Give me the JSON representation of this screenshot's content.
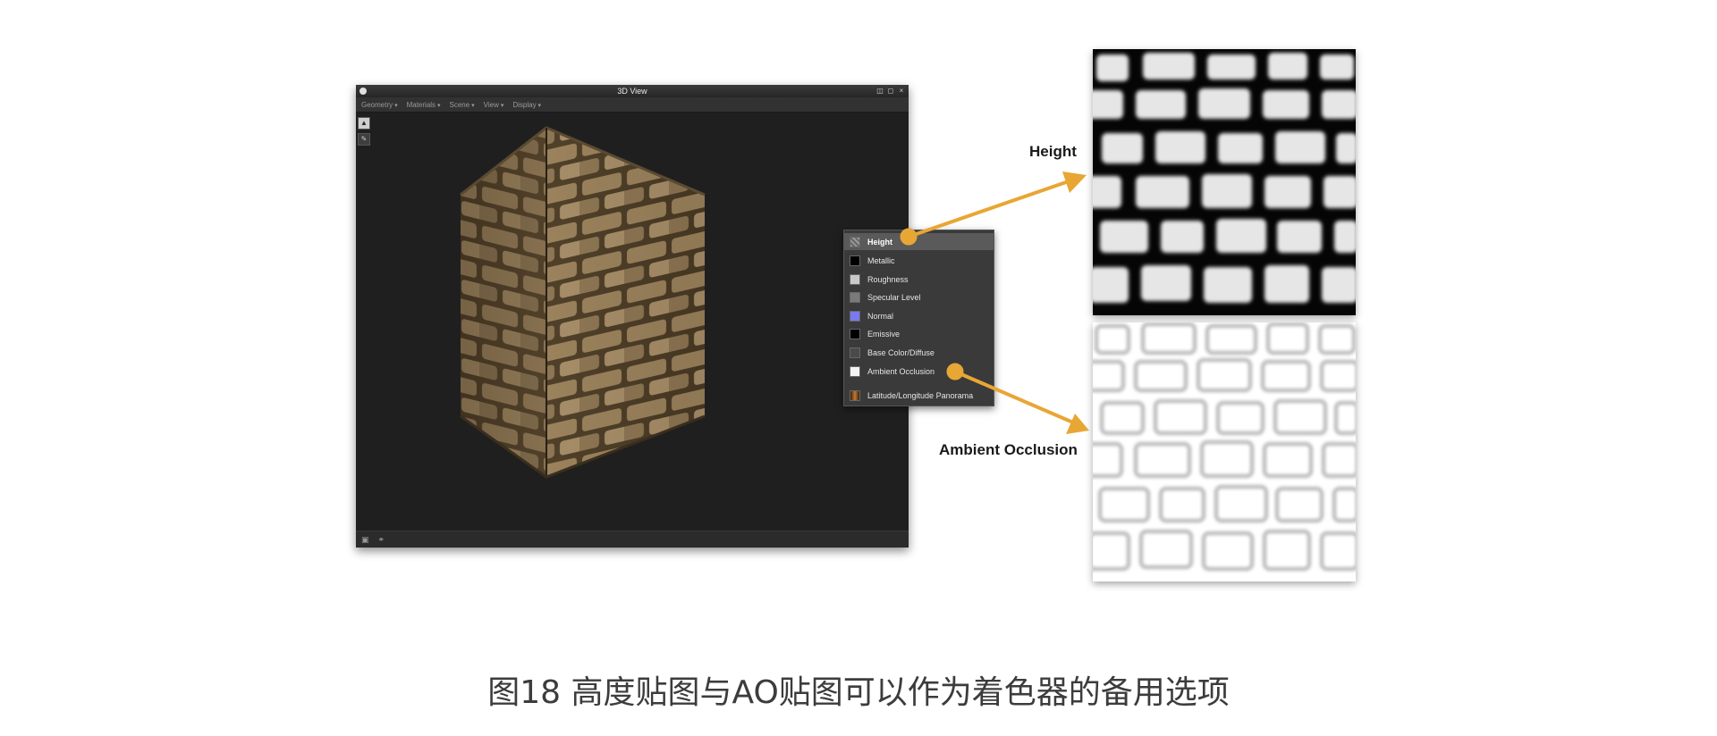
{
  "window": {
    "title": "3D View",
    "menus": [
      "Geometry",
      "Materials",
      "Scene",
      "View",
      "Display"
    ],
    "controls": [
      "restore-icon",
      "float-icon",
      "close-icon"
    ]
  },
  "channel_menu": {
    "items": [
      {
        "label": "Height",
        "swatch": "#8a8a8a",
        "selected": true
      },
      {
        "label": "Metallic",
        "swatch": "#000000"
      },
      {
        "label": "Roughness",
        "swatch": "#c9c9c9"
      },
      {
        "label": "Specular Level",
        "swatch": "#7a7a7a"
      },
      {
        "label": "Normal",
        "swatch": "#7a7af0"
      },
      {
        "label": "Emissive",
        "swatch": "#000000"
      },
      {
        "label": "Base Color/Diffuse",
        "swatch": "#4a4a4a"
      },
      {
        "label": "Ambient Occlusion",
        "swatch": "#f2f2f2"
      },
      {
        "label": "Latitude/Longitude Panorama",
        "swatch": "#7a4a20"
      }
    ]
  },
  "callouts": {
    "height": "Height",
    "ao": "Ambient Occlusion"
  },
  "colors": {
    "accent_arrow": "#e8a634",
    "window_bg": "#1f1f1f"
  },
  "caption": "图18 高度贴图与AO贴图可以作为着色器的备用选项"
}
